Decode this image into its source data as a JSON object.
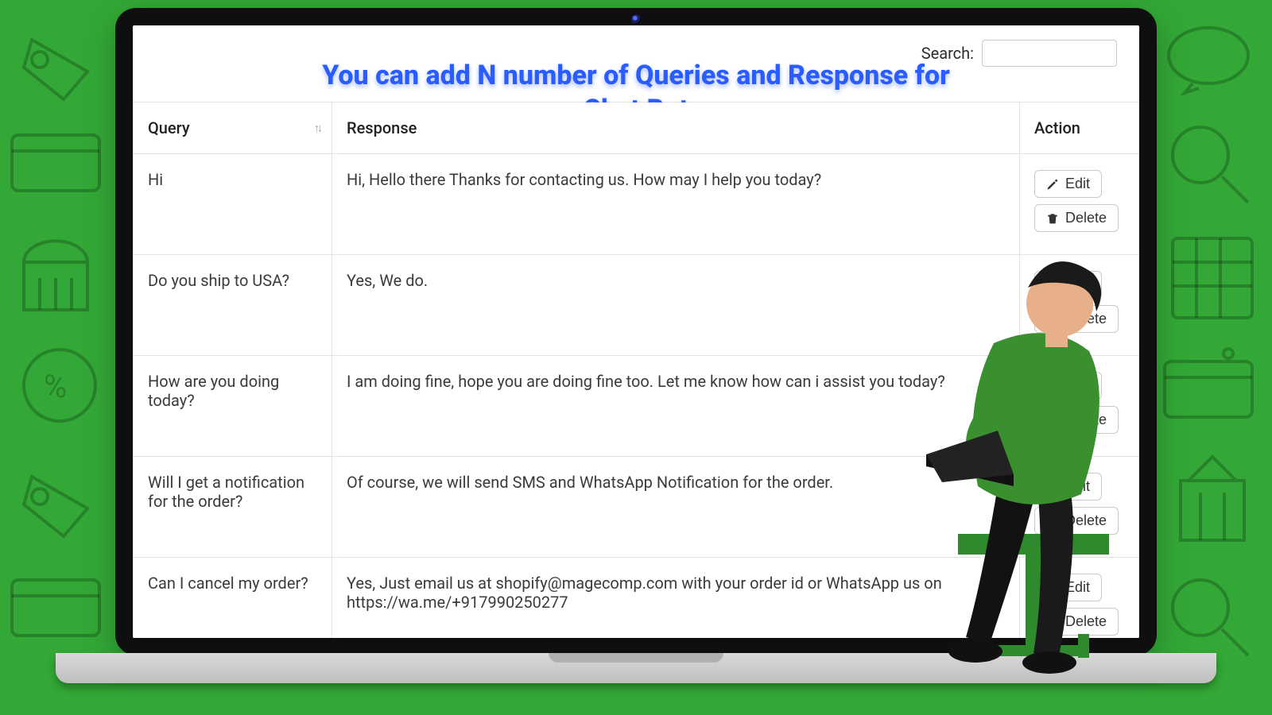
{
  "title": "You can add N number of Queries and Response for Chat Bot",
  "search": {
    "label": "Search:",
    "value": ""
  },
  "columns": {
    "query": "Query",
    "response": "Response",
    "action": "Action"
  },
  "buttons": {
    "edit": "Edit",
    "delete": "Delete"
  },
  "rows": [
    {
      "query": "Hi",
      "response": "Hi, Hello there Thanks for contacting us. How may I help you today?"
    },
    {
      "query": "Do you ship to USA?",
      "response": "Yes, We do."
    },
    {
      "query": "How are you doing today?",
      "response": "I am doing fine, hope you are doing fine too. Let me know how can i assist you today?"
    },
    {
      "query": "Will I get a notification for the order?",
      "response": "Of course, we will send SMS and WhatsApp Notification for the order."
    },
    {
      "query": "Can I cancel my order?",
      "response": "Yes, Just email us at shopify@magecomp.com with your order id or WhatsApp us on https://wa.me/+917990250277"
    }
  ]
}
